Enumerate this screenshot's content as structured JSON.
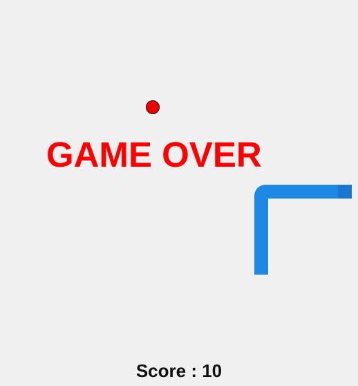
{
  "game": {
    "status_text": "GAME OVER",
    "score_label": "Score : 10",
    "colors": {
      "background": "#f0f0f0",
      "snake_body": "#1e88e5",
      "snake_head": "#1976d2",
      "food": "#ee0000",
      "game_over_text": "#ff0000",
      "score_text": "#111111"
    }
  }
}
